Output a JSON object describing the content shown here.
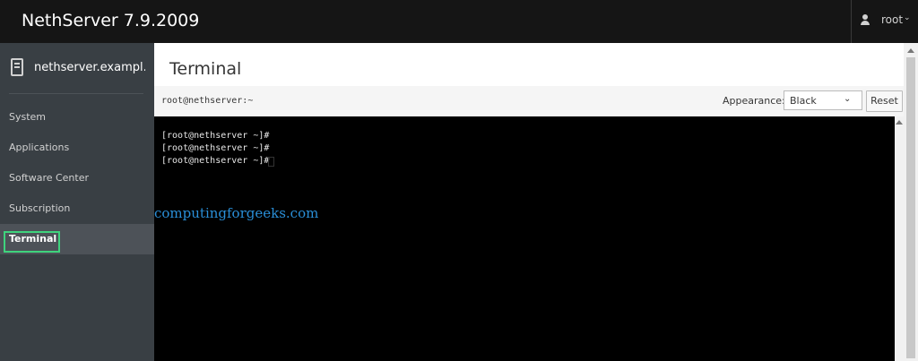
{
  "header": {
    "brand": "NethServer 7.9.2009",
    "user": "root",
    "user_icon": "user-icon",
    "chevron": "⌄"
  },
  "sidebar": {
    "host": "nethserver.exampl...",
    "host_icon": "server-icon",
    "items": [
      {
        "label": "System"
      },
      {
        "label": "Applications"
      },
      {
        "label": "Software Center"
      },
      {
        "label": "Subscription"
      },
      {
        "label": "Terminal",
        "active": true
      }
    ]
  },
  "main": {
    "title": "Terminal",
    "toolbar": {
      "prompt": "root@nethserver:~",
      "appearance_label": "Appearance:",
      "appearance_value": "Black",
      "reset_label": "Reset"
    },
    "terminal": {
      "lines": [
        "[root@nethserver ~]#",
        "[root@nethserver ~]#",
        "[root@nethserver ~]#"
      ]
    },
    "watermark": "computingforgeeks.com"
  },
  "colors": {
    "topbar": "#151515",
    "sidebar": "#393f44",
    "sidebar_active": "#4d5258",
    "highlight": "#3fd37d",
    "terminal_bg": "#000000",
    "watermark": "#2a8fd8"
  }
}
